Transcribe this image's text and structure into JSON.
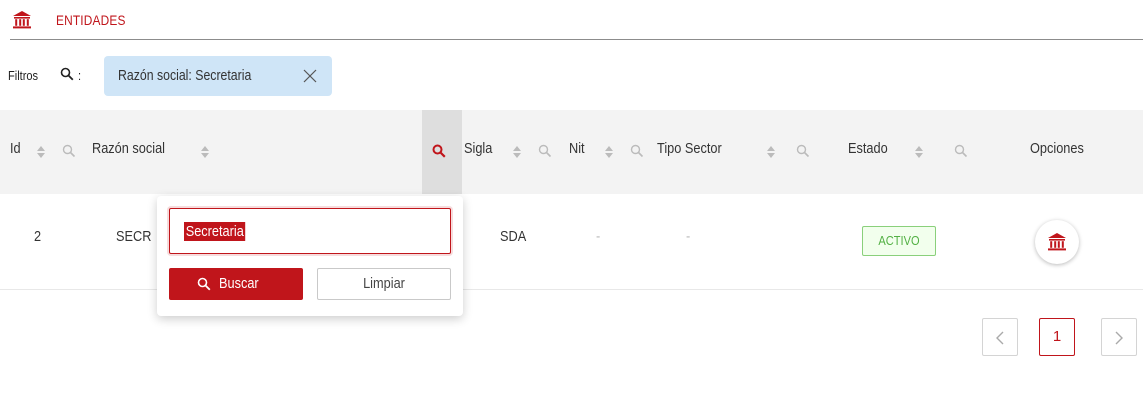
{
  "header": {
    "title": "ENTIDADES",
    "icon": "bank-icon",
    "accent": "#c0151b"
  },
  "filters": {
    "label": "Filtros",
    "label_icon": "search-icon",
    "colon": ":",
    "chips": [
      {
        "text": "Razón social: Secretaria",
        "close_icon": "close-icon"
      }
    ]
  },
  "table": {
    "columns": [
      {
        "label": "Id",
        "sortable": true,
        "searchable": true
      },
      {
        "label": "Razón social",
        "sortable": true,
        "searchable": true,
        "filter_active": true
      },
      {
        "label": "Sigla",
        "sortable": true,
        "searchable": true
      },
      {
        "label": "Nit",
        "sortable": true,
        "searchable": true
      },
      {
        "label": "Tipo Sector",
        "sortable": true,
        "searchable": true
      },
      {
        "label": "Estado",
        "sortable": true,
        "searchable": true
      },
      {
        "label": "Opciones",
        "sortable": false,
        "searchable": false
      }
    ],
    "rows": [
      {
        "id": "2",
        "razon_social": "SECR",
        "sigla": "SDA",
        "nit": "-",
        "tipo_sector": "-",
        "estado": "ACTIVO",
        "option_icon": "bank-icon"
      }
    ]
  },
  "search_popover": {
    "input_value": "Secretaria",
    "search_button": "Buscar",
    "search_button_icon": "search-icon",
    "clear_button": "Limpiar"
  },
  "pagination": {
    "prev_icon": "chevron-left-icon",
    "current_page": "1",
    "next_icon": "chevron-right-icon"
  },
  "colors": {
    "primary": "#c0151b",
    "chip_bg": "#cfe5f7",
    "status_active": "#52b043",
    "status_active_bg": "#f2ffed"
  }
}
